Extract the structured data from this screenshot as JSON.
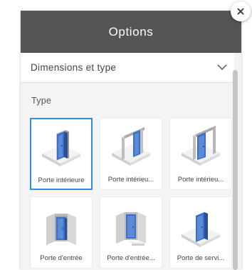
{
  "panel": {
    "title": "Options",
    "section": {
      "title": "Dimensions et type",
      "chevron_icon": "chevron-down-icon"
    },
    "type_label": "Type",
    "door_types": [
      {
        "label": "Porte intérieure",
        "icon": "interior-door-icon",
        "selected": true
      },
      {
        "label": "Porte intérieu...",
        "icon": "interior-sliding-door-icon",
        "selected": false
      },
      {
        "label": "Porte intérieu...",
        "icon": "interior-pocket-door-icon",
        "selected": false
      },
      {
        "label": "Porte d'entrée",
        "icon": "entrance-door-icon",
        "selected": false
      },
      {
        "label": "Porte d'entrée...",
        "icon": "entrance-door-step-icon",
        "selected": false
      },
      {
        "label": "Porte de servi...",
        "icon": "service-door-icon",
        "selected": false
      }
    ]
  },
  "close_icon": "close-icon",
  "colors": {
    "header_bg": "#555555",
    "selected_border": "#2f8fe0",
    "door_blue": "#3c6fc4"
  }
}
